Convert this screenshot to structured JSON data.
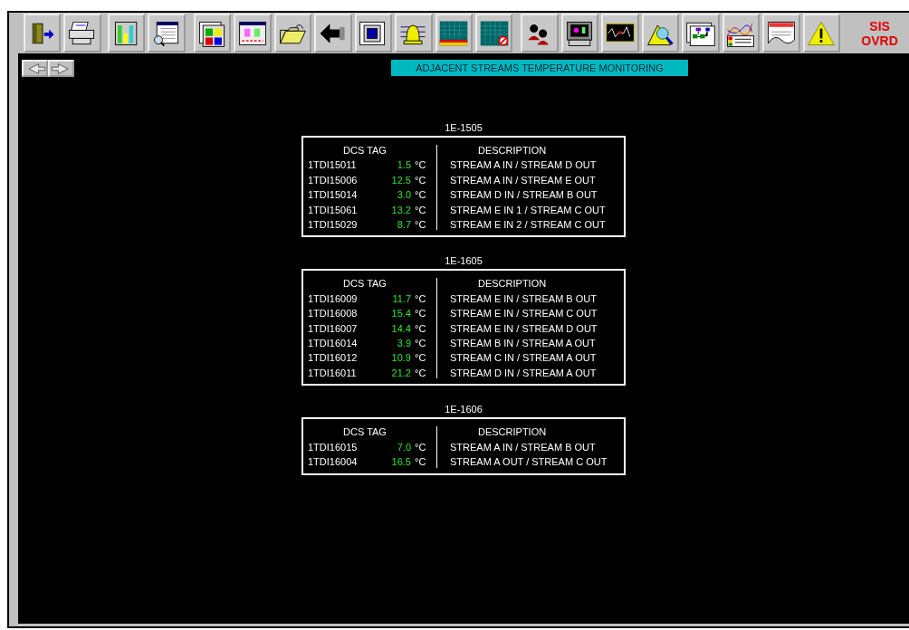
{
  "toolbar": {
    "override_button": "SIS OVRD"
  },
  "page_title": "ADJACENT STREAMS TEMPERATURE MONITORING",
  "exchangers": [
    {
      "name": "1E-1505",
      "columns": [
        "DCS TAG",
        "DESCRIPTION"
      ],
      "rows": [
        {
          "tag": "1TDI15011",
          "value": "1.5",
          "unit": "°C",
          "description": "STREAM A IN / STREAM D OUT"
        },
        {
          "tag": "1TDI15006",
          "value": "12.5",
          "unit": "°C",
          "description": "STREAM A IN / STREAM E OUT"
        },
        {
          "tag": "1TDI15014",
          "value": "3.0",
          "unit": "°C",
          "description": "STREAM D IN / STREAM B OUT"
        },
        {
          "tag": "1TDI15061",
          "value": "13.2",
          "unit": "°C",
          "description": "STREAM E IN 1 / STREAM C OUT"
        },
        {
          "tag": "1TDI15029",
          "value": "8.7",
          "unit": "°C",
          "description": "STREAM E IN 2 / STREAM C OUT"
        }
      ]
    },
    {
      "name": "1E-1605",
      "columns": [
        "DCS TAG",
        "DESCRIPTION"
      ],
      "rows": [
        {
          "tag": "1TDI16009",
          "value": "11.7",
          "unit": "°C",
          "description": "STREAM E IN / STREAM B OUT"
        },
        {
          "tag": "1TDI16008",
          "value": "15.4",
          "unit": "°C",
          "description": "STREAM E IN / STREAM C OUT"
        },
        {
          "tag": "1TDI16007",
          "value": "14.4",
          "unit": "°C",
          "description": "STREAM E IN / STREAM D OUT"
        },
        {
          "tag": "1TDI16014",
          "value": "3.9",
          "unit": "°C",
          "description": "STREAM B IN / STREAM A OUT"
        },
        {
          "tag": "1TDI16012",
          "value": "10.9",
          "unit": "°C",
          "description": "STREAM C IN / STREAM A OUT"
        },
        {
          "tag": "1TDI16011",
          "value": "21.2",
          "unit": "°C",
          "description": "STREAM D IN / STREAM A OUT"
        }
      ]
    },
    {
      "name": "1E-1606",
      "columns": [
        "DCS TAG",
        "DESCRIPTION"
      ],
      "rows": [
        {
          "tag": "1TDI16015",
          "value": "7.0",
          "unit": "°C",
          "description": "STREAM A IN / STREAM B OUT"
        },
        {
          "tag": "1TDI16004",
          "value": "16.5",
          "unit": "°C",
          "description": "STREAM A OUT / STREAM C OUT"
        }
      ]
    }
  ]
}
